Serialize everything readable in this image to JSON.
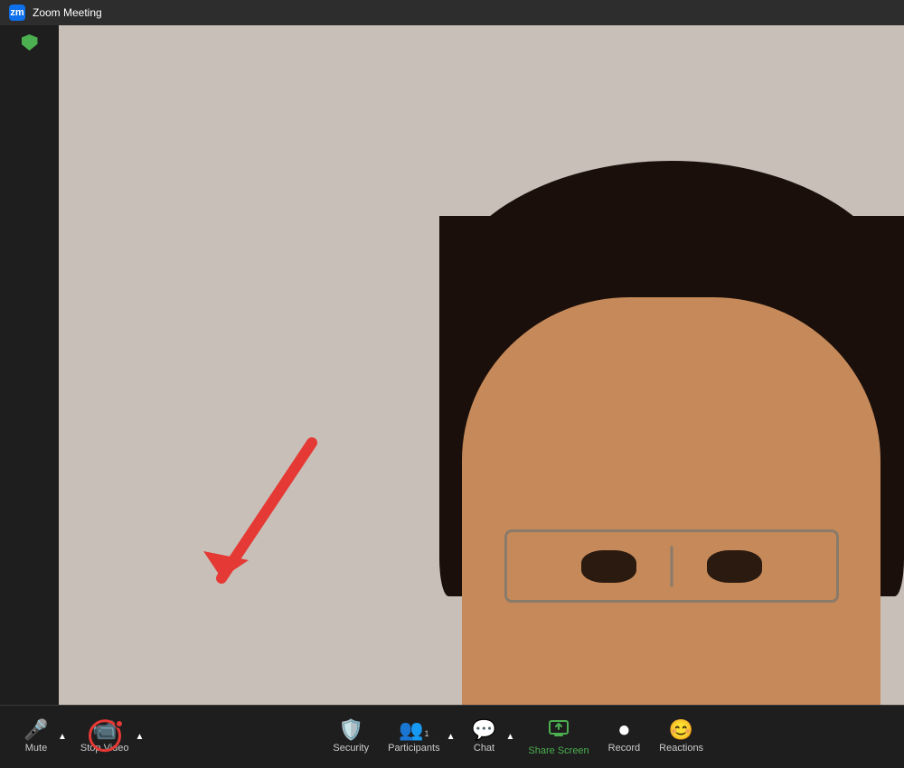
{
  "titleBar": {
    "title": "Zoom Meeting",
    "iconColor": "#0e71eb"
  },
  "toolbar": {
    "mute": {
      "label": "Mute",
      "icon": "🎤"
    },
    "stopVideo": {
      "label": "Stop Video",
      "icon": "📹"
    },
    "security": {
      "label": "Security",
      "icon": "🛡"
    },
    "participants": {
      "label": "Participants",
      "count": "1",
      "icon": "👥"
    },
    "chat": {
      "label": "Chat",
      "icon": "💬"
    },
    "shareScreen": {
      "label": "Share Screen",
      "icon": "⬆"
    },
    "record": {
      "label": "Record",
      "icon": "⏺"
    },
    "reactions": {
      "label": "Reactions",
      "icon": "😊"
    }
  },
  "video": {
    "bgColor": "#c8c0b8"
  }
}
